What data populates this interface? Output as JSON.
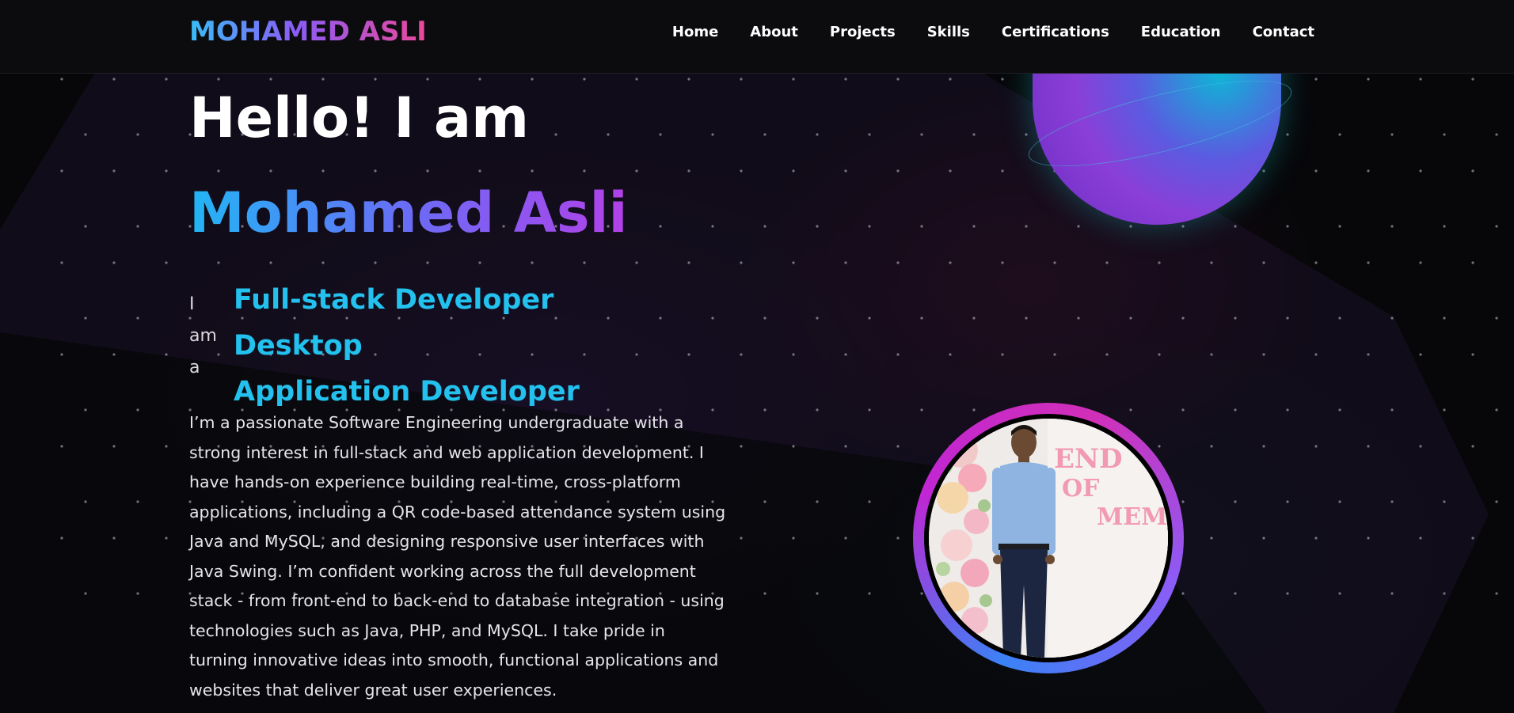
{
  "header": {
    "logo": "MOHAMED ASLI",
    "nav": [
      "Home",
      "About",
      "Projects",
      "Skills",
      "Certifications",
      "Education",
      "Contact"
    ]
  },
  "hero": {
    "greeting": "Hello! I am",
    "name": "Mohamed Asli",
    "prefix_lines": [
      "I",
      "am",
      "a"
    ],
    "role_lines": [
      "Full-stack Developer Desktop",
      "Application Developer"
    ],
    "bio": "I’m a passionate Software Engineering undergraduate with a strong interest in full-stack and web application development. I have hands-on experience building real-time, cross-platform applications, including a QR code-based attendance system using Java and MySQL, and designing responsive user interfaces with Java Swing. I’m confident working across the full development stack - from front-end to back-end to database integration - using technologies such as Java, PHP, and MySQL. I take pride in turning innovative ideas into smooth, functional applications and websites that deliver great user experiences."
  },
  "photo": {
    "banner_lines": [
      "END",
      "OF",
      "MEMO"
    ]
  },
  "colors": {
    "background": "#07070a",
    "header_bg": "#0c0c0e",
    "accent_cyan": "#22c1ee",
    "accent_purple": "#8b5cf6",
    "accent_pink": "#ec4899"
  }
}
